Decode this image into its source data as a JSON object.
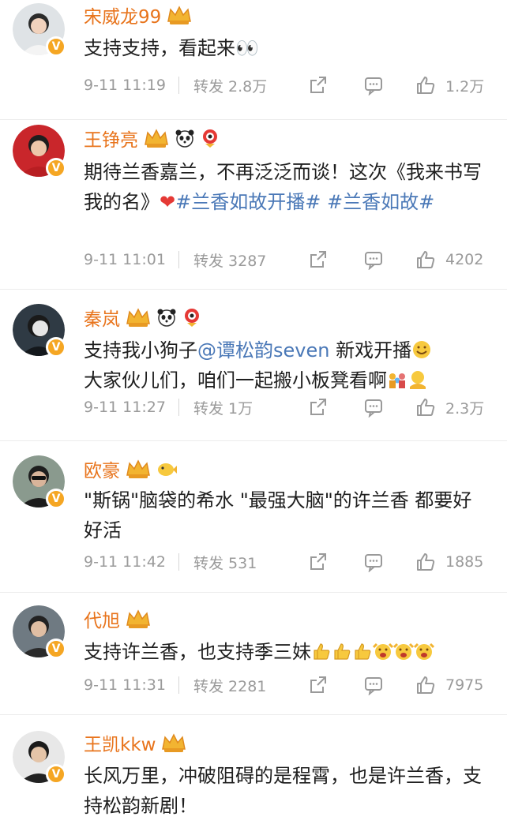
{
  "colors": {
    "name": "#e8741c",
    "topic": "#4a78b7",
    "meta": "#9a9a9a",
    "badge": "#f5a623"
  },
  "comments": [
    {
      "name": "宋威龙99",
      "badges": [
        "crown-icon"
      ],
      "text": "支持支持，看起来👀",
      "time": "9-11 11:19",
      "forward": "转发 2.8万",
      "likes": "1.2万"
    },
    {
      "name": "王铮亮",
      "badges": [
        "crown-icon",
        "panda-icon",
        "mascot-icon"
      ],
      "text_parts": [
        "期待兰香嘉兰，不再泛泛而谈！这次《我来书写我的名》",
        "❤",
        "#兰香如故开播#",
        " ",
        "#兰香如故#"
      ],
      "time": "9-11 11:01",
      "forward": "转发 3287",
      "likes": "4202"
    },
    {
      "name": "秦岚",
      "badges": [
        "crown-icon",
        "panda-icon",
        "mascot-icon"
      ],
      "text_parts": [
        "支持我小狗子",
        "@谭松韵seven",
        " 新戏开播",
        "大家伙儿们，咱们一起搬小板凳看啊"
      ],
      "time": "9-11 11:27",
      "forward": "转发 1万",
      "likes": "2.3万"
    },
    {
      "name": "欧豪",
      "badges": [
        "crown-icon",
        "pufferfish-icon"
      ],
      "text": "\"斯锅\"脑袋的希水 \"最强大脑\"的许兰香 都要好好活",
      "time": "9-11 11:42",
      "forward": "转发 531",
      "likes": "1885"
    },
    {
      "name": "代旭",
      "badges": [
        "crown-icon"
      ],
      "text": "支持许兰香，也支持季三妹",
      "time": "9-11 11:31",
      "forward": "转发 2281",
      "likes": "7975"
    },
    {
      "name": "王凯kkw",
      "badges": [
        "crown-icon"
      ],
      "text": "长风万里，冲破阻碍的是程霄，也是许兰香，支持松韵新剧！"
    }
  ]
}
